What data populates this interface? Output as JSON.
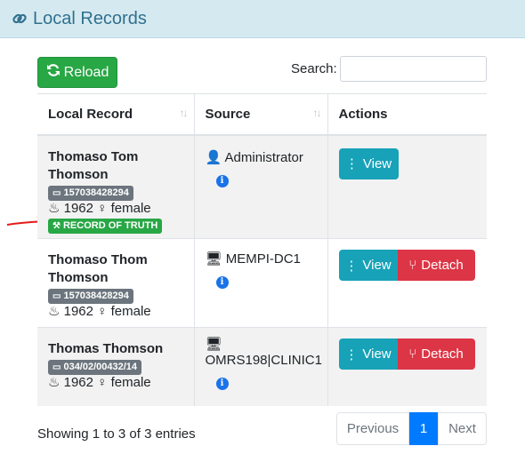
{
  "header": {
    "title": "Local Records",
    "icon": "link-icon"
  },
  "toolbar": {
    "reload_label": "Reload",
    "search_label": "Search:",
    "search_value": ""
  },
  "table": {
    "columns": [
      "Local Record",
      "Source",
      "Actions"
    ],
    "rows": [
      {
        "name": "Thomaso Tom Thomson",
        "id": "157038428294",
        "birth_year": "1962",
        "gender": "female",
        "truth_badge": "RECORD OF TRUTH",
        "source": "Administrator",
        "actions": {
          "view": "View"
        }
      },
      {
        "name": "Thomaso Thom Thomson",
        "id": "157038428294",
        "birth_year": "1962",
        "gender": "female",
        "source": "MEMPI-DC1",
        "actions": {
          "view": "View",
          "detach": "Detach"
        }
      },
      {
        "name": "Thomas Thomson",
        "id": "034/02/00432/14",
        "birth_year": "1962",
        "gender": "female",
        "source": "OMRS198|CLINIC1",
        "actions": {
          "view": "View",
          "detach": "Detach"
        }
      }
    ]
  },
  "footer": {
    "info": "Showing 1 to 3 of 3 entries",
    "pagination": {
      "previous": "Previous",
      "current": "1",
      "next": "Next"
    }
  },
  "colors": {
    "header_bg": "#d5eaf0",
    "success": "#28a745",
    "info": "#17a2b8",
    "danger": "#dc3545",
    "primary": "#007bff"
  }
}
